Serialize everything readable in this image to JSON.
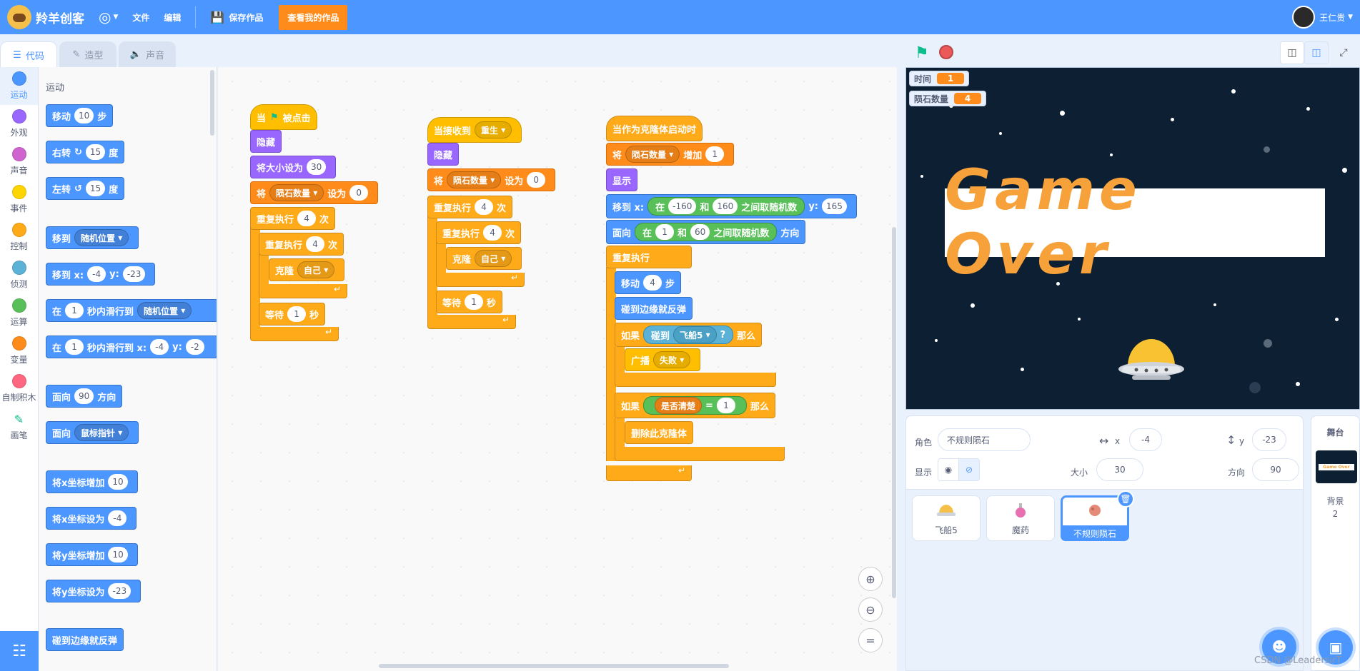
{
  "menubar": {
    "app_name": "羚羊创客",
    "file": "文件",
    "edit": "编辑",
    "save": "保存作品",
    "my_works": "查看我的作品",
    "username": "王仁贵"
  },
  "tabs": [
    "代码",
    "造型",
    "声音"
  ],
  "categories": [
    {
      "label": "运动",
      "color": "#4c97ff"
    },
    {
      "label": "外观",
      "color": "#9966ff"
    },
    {
      "label": "声音",
      "color": "#cf63cf"
    },
    {
      "label": "事件",
      "color": "#ffd500"
    },
    {
      "label": "控制",
      "color": "#ffab19"
    },
    {
      "label": "侦测",
      "color": "#5cb1d6"
    },
    {
      "label": "运算",
      "color": "#59c059"
    },
    {
      "label": "变量",
      "color": "#ff8c1a"
    },
    {
      "label": "自制积木",
      "color": "#ff6680"
    },
    {
      "label": "画笔",
      "color": "#0fbd8c"
    }
  ],
  "flyout": {
    "heading": "运动",
    "move": "移动",
    "move_n": "10",
    "steps": "步",
    "turn_right": "右转",
    "turn_left": "左转",
    "turn_n": "15",
    "degrees": "度",
    "goto": "移到",
    "random_pos": "随机位置",
    "goto_xy": "移到 x:",
    "x_val": "-4",
    "y_label": "y:",
    "y_val": "-23",
    "glide_in": "在",
    "glide_n": "1",
    "glide_to": "秒内滑行到",
    "glide_to_xy": "秒内滑行到 x:",
    "y_trunc": "-2",
    "point_dir": "面向",
    "dir_n": "90",
    "direction": "方向",
    "point_towards": "面向",
    "mouse_pointer": "鼠标指针",
    "change_x": "将x坐标增加",
    "change_x_n": "10",
    "set_x": "将x坐标设为",
    "set_x_n": "-4",
    "change_y": "将y坐标增加",
    "change_y_n": "10",
    "set_y": "将y坐标设为",
    "set_y_n": "-23",
    "bounce": "碰到边缘就反弹"
  },
  "script1": {
    "when": "当",
    "clicked": "被点击",
    "hide": "隐藏",
    "set_size": "将大小设为",
    "size": "30",
    "set_var": "将",
    "var_name": "陨石数量",
    "set_to": "设为",
    "var_val": "0",
    "repeat": "重复执行",
    "repeat_n": "4",
    "times": "次",
    "inner_repeat": "重复执行",
    "inner_n": "4",
    "clone": "克隆",
    "self": "自己",
    "wait": "等待",
    "wait_n": "1",
    "seconds": "秒"
  },
  "script2": {
    "when_receive": "当接收到",
    "msg": "重生",
    "hide": "隐藏",
    "set_var": "将",
    "var_name": "陨石数量",
    "set_to": "设为",
    "var_val": "0",
    "repeat": "重复执行",
    "repeat_n": "4",
    "times": "次",
    "inner_repeat": "重复执行",
    "inner_n": "4",
    "clone": "克隆",
    "self": "自己",
    "wait": "等待",
    "wait_n": "1",
    "seconds": "秒"
  },
  "script3": {
    "clone_start": "当作为克隆体启动时",
    "change_var": "将",
    "var_name": "陨石数量",
    "increase": "增加",
    "inc_n": "1",
    "show": "显示",
    "goto_x": "移到 x:",
    "rand_in": "在",
    "rand_a": "-160",
    "and": "和",
    "rand_b": "160",
    "rand_pick": "之间取随机数",
    "y_label": "y:",
    "y_val": "165",
    "point": "面向",
    "dir_a": "1",
    "dir_b": "60",
    "direction": "方向",
    "forever": "重复执行",
    "move": "移动",
    "move_n": "4",
    "steps": "步",
    "bounce": "碰到边缘就反弹",
    "if": "如果",
    "touching": "碰到",
    "target": "飞船5",
    "q": "?",
    "then": "那么",
    "broadcast": "广播",
    "bmsg": "失败",
    "if2": "如果",
    "cleared": "是否清楚",
    "eq": "=",
    "eq_val": "1",
    "then2": "那么",
    "delete_clone": "删除此克隆体"
  },
  "stage": {
    "monitor_time_label": "时间",
    "monitor_time_value": "1",
    "monitor_meteor_label": "陨石数量",
    "monitor_meteor_value": "4",
    "game_over": "Game Over"
  },
  "sprite_info": {
    "sprite_label": "角色",
    "sprite_name": "不规则陨石",
    "x_label": "x",
    "x": "-4",
    "y_label": "y",
    "y": "-23",
    "show_label": "显示",
    "size_label": "大小",
    "size": "30",
    "dir_label": "方向",
    "direction": "90"
  },
  "sprites": [
    {
      "name": "飞船5",
      "color": "#f5c04a"
    },
    {
      "name": "魔药",
      "color": "#e86fb0"
    },
    {
      "name": "不规则陨石",
      "color": "#e48a78"
    }
  ],
  "stage_panel": {
    "title": "舞台",
    "backdrop_label": "背景",
    "backdrop_count": "2"
  },
  "watermark": "CSDN @LeadersirT"
}
